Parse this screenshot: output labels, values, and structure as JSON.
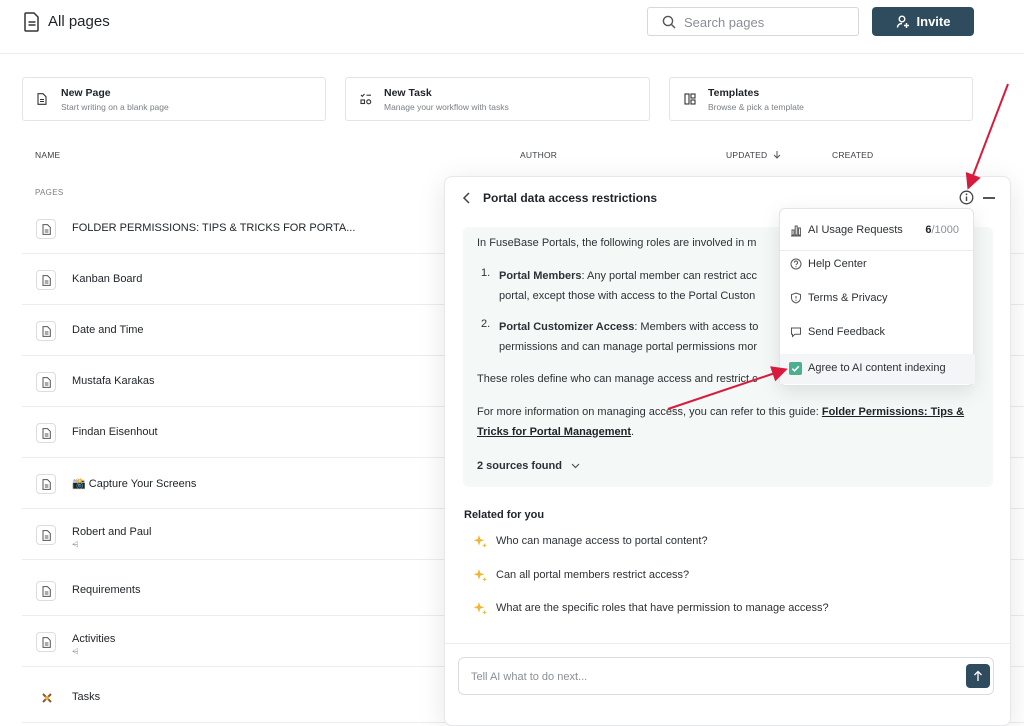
{
  "header": {
    "title": "All pages",
    "search_placeholder": "Search pages",
    "invite_label": "Invite"
  },
  "quick_actions": [
    {
      "title": "New Page",
      "subtitle": "Start writing on a blank page",
      "icon": "page-icon"
    },
    {
      "title": "New Task",
      "subtitle": "Manage your workflow with tasks",
      "icon": "task-icon"
    },
    {
      "title": "Templates",
      "subtitle": "Browse & pick a template",
      "icon": "templates-icon"
    }
  ],
  "table": {
    "columns": {
      "name": "NAME",
      "author": "AUTHOR",
      "updated": "UPDATED",
      "created": "CREATED"
    },
    "section": "PAGES",
    "rows": [
      {
        "name": "FOLDER PERMISSIONS: TIPS & TRICKS FOR PORTA...",
        "sub": ""
      },
      {
        "name": "Kanban Board",
        "sub": ""
      },
      {
        "name": "Date and Time",
        "sub": ""
      },
      {
        "name": "Mustafa Karakas",
        "sub": ""
      },
      {
        "name": "Findan Eisenhout",
        "sub": ""
      },
      {
        "name": "📸 Capture Your Screens",
        "sub": ""
      },
      {
        "name": "Robert and Paul",
        "sub": "⩤"
      },
      {
        "name": "Requirements",
        "sub": ""
      },
      {
        "name": "Activities",
        "sub": "⩤"
      },
      {
        "name": "Tasks",
        "sub": ""
      }
    ]
  },
  "ai_panel": {
    "title": "Portal data access restrictions",
    "intro": "In FuseBase Portals, the following roles are involved in m",
    "items": [
      {
        "num": "1.",
        "bold": "Portal Members",
        "line1": ": Any portal member can restrict acc",
        "line2": "portal, except those with access to the Portal Custon"
      },
      {
        "num": "2.",
        "bold": "Portal Customizer Access",
        "line1": ": Members with access to",
        "line2": "permissions and can manage portal permissions mor"
      }
    ],
    "roles_text": "These roles define who can manage access and restrict c",
    "more_text": "For more information on managing access, you can refer to this guide: ",
    "more_link": "Folder Permissions: Tips & Tricks for Portal Management",
    "more_end": ".",
    "sources": "2 sources found",
    "related_heading": "Related for you",
    "related": [
      "Who can manage access to portal content?",
      "Can all portal members restrict access?",
      "What are the specific roles that have permission to manage access?"
    ],
    "ask_placeholder": "Tell AI what to do next..."
  },
  "menu": {
    "usage_label": "AI Usage Requests",
    "usage_used": "6",
    "usage_limit": "/1000",
    "items": [
      "Help Center",
      "Terms & Privacy",
      "Send Feedback"
    ],
    "indexing_label": "Agree to AI content indexing",
    "indexing_checked": true
  },
  "colors": {
    "accent": "#2f4c5f",
    "answer_bg": "#f4f8f6",
    "check": "#4caf8e",
    "annotation_arrow": "#d81b3c"
  }
}
